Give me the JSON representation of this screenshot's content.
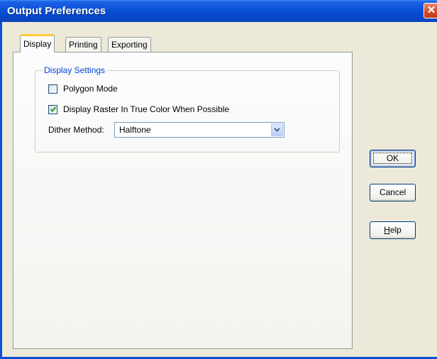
{
  "window": {
    "title": "Output Preferences",
    "close_glyph": "✕"
  },
  "tabs": [
    {
      "label": "Display",
      "active": true
    },
    {
      "label": "Printing",
      "active": false
    },
    {
      "label": "Exporting",
      "active": false
    }
  ],
  "display_settings": {
    "group_title": "Display Settings",
    "polygon_mode": {
      "label": "Polygon Mode",
      "checked": false
    },
    "true_color": {
      "label": "Display Raster In True Color When Possible",
      "checked": true
    },
    "dither": {
      "label": "Dither Method:",
      "value": "Halftone"
    }
  },
  "buttons": {
    "ok": "OK",
    "cancel": "Cancel",
    "help_prefix": "H",
    "help_rest": "elp"
  },
  "icons": {
    "close": "close-icon",
    "dropdown": "chevron-down-icon",
    "check": "checkmark-icon"
  },
  "colors": {
    "titlebar": "#0a52d6",
    "group_title": "#0046d5",
    "active_tab_highlight": "#ffc83c",
    "checkmark": "#21a121"
  }
}
